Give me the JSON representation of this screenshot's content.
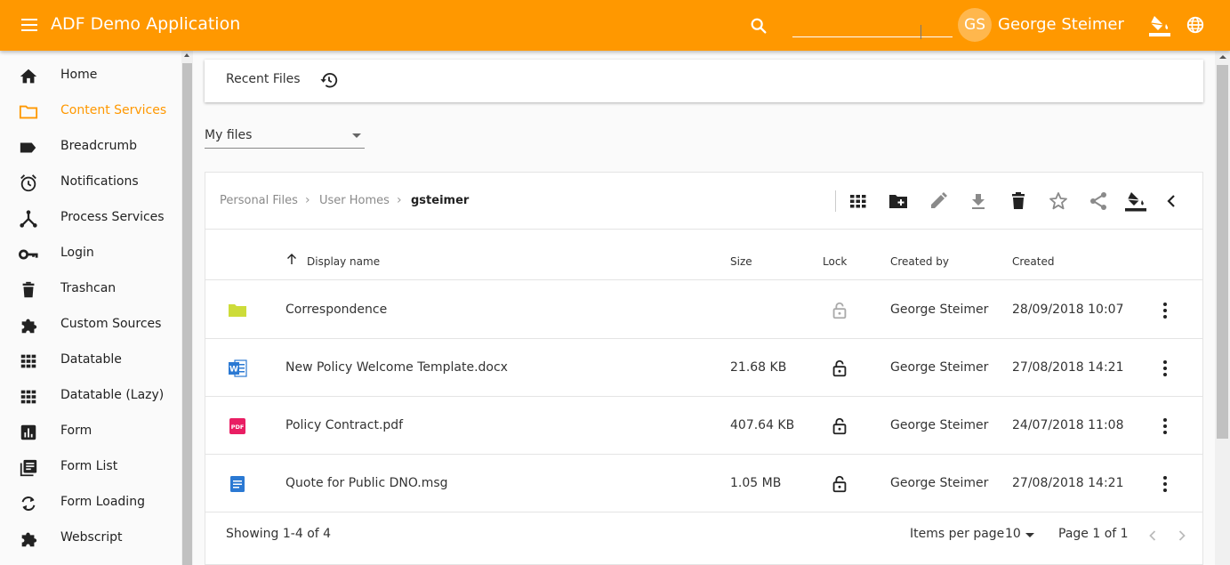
{
  "header": {
    "title": "ADF Demo Application",
    "search_value": "",
    "avatar_initials": "GS",
    "username": "George Steimer",
    "bar_color": "#ff9800",
    "icons": [
      "menu-icon",
      "search-icon",
      "paint-bucket-icon",
      "globe-icon"
    ]
  },
  "sidebar": {
    "items": [
      {
        "label": "Home",
        "icon": "home-icon"
      },
      {
        "label": "Content Services",
        "icon": "folder-icon",
        "active": true
      },
      {
        "label": "Breadcrumb",
        "icon": "label-icon"
      },
      {
        "label": "Notifications",
        "icon": "alarm-icon"
      },
      {
        "label": "Process Services",
        "icon": "process-icon"
      },
      {
        "label": "Login",
        "icon": "key-icon"
      },
      {
        "label": "Trashcan",
        "icon": "trash-icon"
      },
      {
        "label": "Custom Sources",
        "icon": "puzzle-icon"
      },
      {
        "label": "Datatable",
        "icon": "grid-icon"
      },
      {
        "label": "Datatable (Lazy)",
        "icon": "grid-icon"
      },
      {
        "label": "Form",
        "icon": "chart-icon"
      },
      {
        "label": "Form List",
        "icon": "list-icon"
      },
      {
        "label": "Form Loading",
        "icon": "sync-icon"
      },
      {
        "label": "Webscript",
        "icon": "puzzle-icon"
      }
    ],
    "active_color": "#ff9800"
  },
  "recent": {
    "label": "Recent Files"
  },
  "site_select": {
    "value": "My files"
  },
  "breadcrumb": {
    "items": [
      "Personal Files",
      "User Homes"
    ],
    "current": "gsteimer"
  },
  "toolbar": {
    "icons": [
      "grid-view-icon",
      "create-folder-icon",
      "edit-icon",
      "download-icon",
      "delete-icon",
      "star-icon",
      "share-icon",
      "paint-bucket-icon",
      "chevron-left-icon"
    ]
  },
  "table": {
    "columns": {
      "name": "Display name",
      "size": "Size",
      "lock": "Lock",
      "created_by": "Created by",
      "created": "Created"
    },
    "rows": [
      {
        "icon": "folder-icon",
        "name": "Correspondence",
        "size": "",
        "locked_style": "light",
        "created_by": "George Steimer",
        "created": "28/09/2018 10:07"
      },
      {
        "icon": "word-doc-icon",
        "name": "New Policy Welcome Template.docx",
        "size": "21.68 KB",
        "locked_style": "dark",
        "created_by": "George Steimer",
        "created": "27/08/2018 14:21"
      },
      {
        "icon": "pdf-icon",
        "name": "Policy Contract.pdf",
        "size": "407.64 KB",
        "locked_style": "dark",
        "created_by": "George Steimer",
        "created": "24/07/2018 11:08"
      },
      {
        "icon": "document-icon",
        "name": "Quote for Public DNO.msg",
        "size": "1.05 MB",
        "locked_style": "dark",
        "created_by": "George Steimer",
        "created": "27/08/2018 14:21"
      }
    ]
  },
  "pagination": {
    "showing": "Showing 1-4 of 4",
    "items_per_page_label": "Items per page",
    "items_per_page": "10",
    "page": "Page 1 of 1"
  }
}
